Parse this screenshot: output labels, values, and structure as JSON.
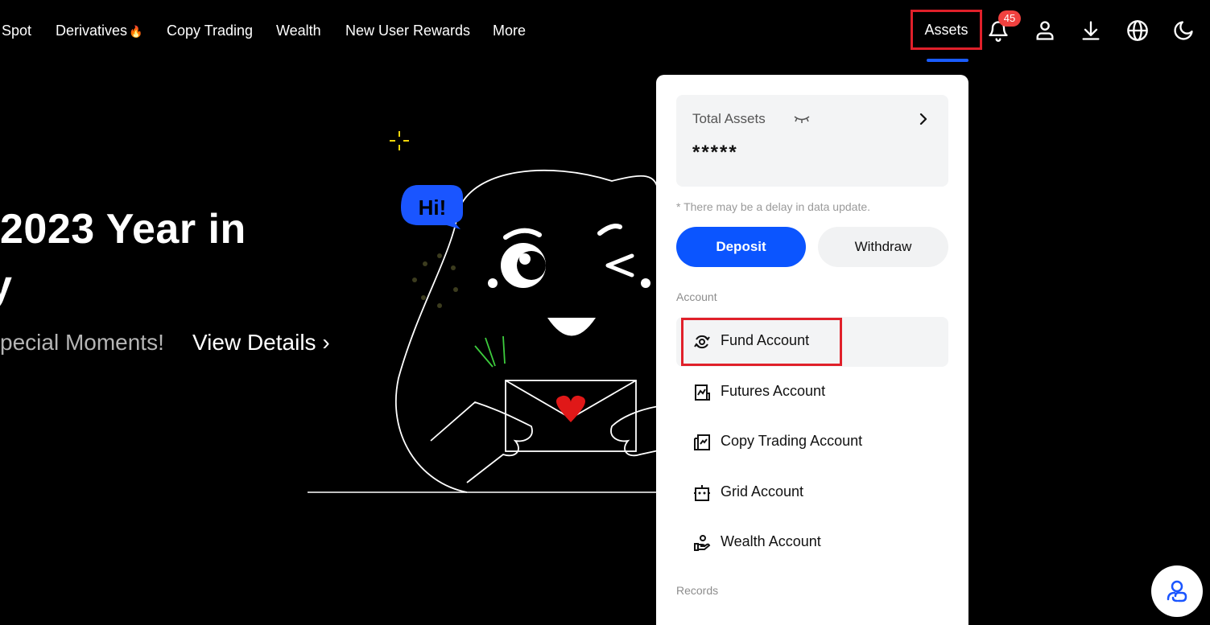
{
  "nav": {
    "items": [
      "Spot",
      "Derivatives",
      "Copy Trading",
      "Wealth",
      "New User Rewards",
      "More"
    ],
    "derivatives_emoji": "🔥",
    "assets_label": "Assets",
    "notification_count": "45",
    "icons": [
      "bell-icon",
      "user-icon",
      "download-icon",
      "globe-icon",
      "moon-icon"
    ]
  },
  "hero": {
    "title_line1": "2023 Year in",
    "title_line2": "y",
    "subtitle": "pecial Moments!",
    "link_text": "View Details ›",
    "speech_bubble": "Hi!"
  },
  "dropdown": {
    "total_label": "Total Assets",
    "total_value": "*****",
    "delay_note": "* There may be a delay in data update.",
    "deposit_label": "Deposit",
    "withdraw_label": "Withdraw",
    "account_section": "Account",
    "accounts": [
      {
        "label": "Fund Account",
        "icon": "fund-icon"
      },
      {
        "label": "Futures Account",
        "icon": "futures-icon"
      },
      {
        "label": "Copy Trading Account",
        "icon": "copy-trading-icon"
      },
      {
        "label": "Grid Account",
        "icon": "grid-bot-icon"
      },
      {
        "label": "Wealth Account",
        "icon": "wealth-hand-icon"
      }
    ],
    "records_section": "Records"
  },
  "colors": {
    "accent": "#0b55ff",
    "highlight": "#e0202a",
    "badge": "#f0413f"
  }
}
